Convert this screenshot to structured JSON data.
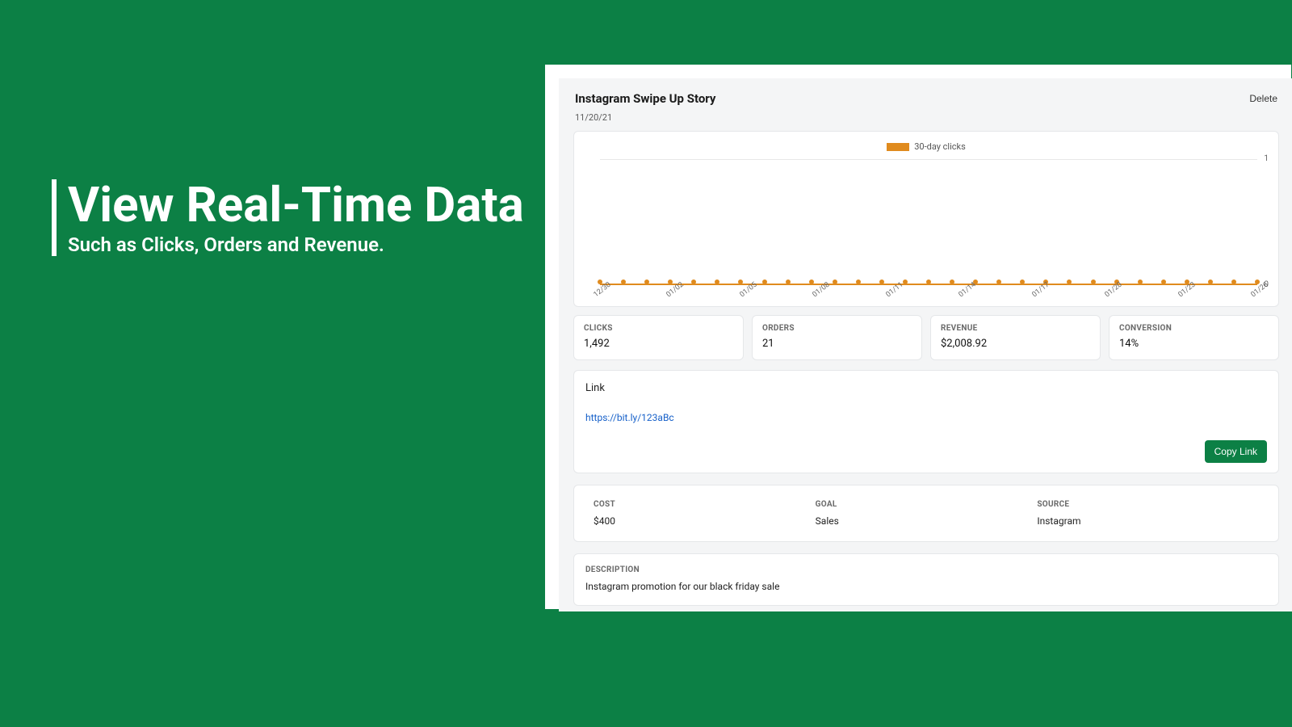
{
  "promo": {
    "title": "View Real-Time Data",
    "subtitle": "Such as Clicks, Orders and Revenue."
  },
  "header": {
    "title": "Instagram Swipe Up Story",
    "delete_label": "Delete",
    "date": "11/20/21"
  },
  "chart_data": {
    "type": "line",
    "legend_label": "30-day clicks",
    "ylim": [
      0,
      1
    ],
    "y_ticks": [
      "1",
      "0"
    ],
    "x_ticks": [
      "12/30",
      "01/02",
      "01/05",
      "01/08",
      "01/11",
      "01/14",
      "01/17",
      "01/20",
      "01/23",
      "01/26"
    ],
    "tick_count": 29,
    "series": [
      {
        "name": "30-day clicks",
        "values": [
          0,
          0,
          0,
          0,
          0,
          0,
          0,
          0,
          0,
          0,
          0,
          0,
          0,
          0,
          0,
          0,
          0,
          0,
          0,
          0,
          0,
          0,
          0,
          0,
          0,
          0,
          0,
          0,
          0
        ]
      }
    ]
  },
  "metrics": [
    {
      "label": "CLICKS",
      "value": "1,492"
    },
    {
      "label": "ORDERS",
      "value": "21"
    },
    {
      "label": "REVENUE",
      "value": "$2,008.92"
    },
    {
      "label": "CONVERSION",
      "value": "14%"
    }
  ],
  "link": {
    "heading": "Link",
    "url": "https://bit.ly/123aBc",
    "copy_label": "Copy Link"
  },
  "details": {
    "cost": {
      "label": "COST",
      "value": "$400"
    },
    "goal": {
      "label": "GOAL",
      "value": "Sales"
    },
    "source": {
      "label": "SOURCE",
      "value": "Instagram"
    }
  },
  "description": {
    "label": "DESCRIPTION",
    "text": "Instagram promotion for our black friday sale"
  }
}
